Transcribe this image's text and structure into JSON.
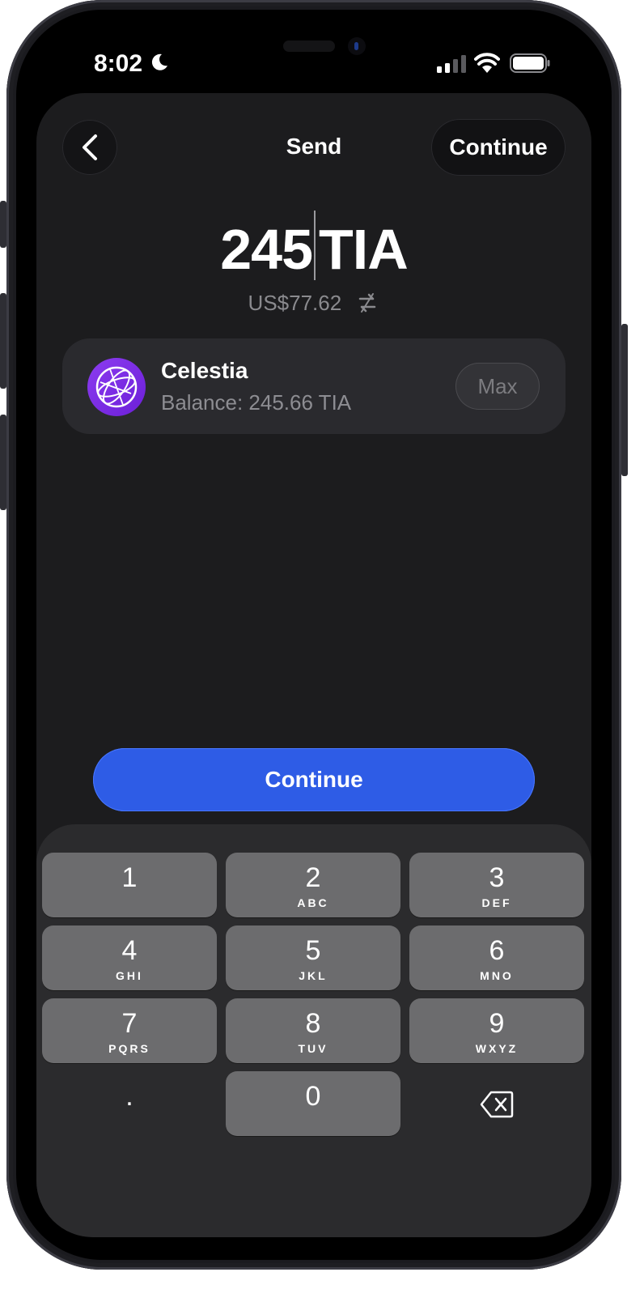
{
  "status_bar": {
    "time": "8:02"
  },
  "nav": {
    "title": "Send",
    "continue_label": "Continue"
  },
  "amount": {
    "value": "245",
    "unit": "TIA",
    "fiat": "US$77.62"
  },
  "token": {
    "name": "Celestia",
    "balance": "Balance: 245.66 TIA",
    "max_label": "Max",
    "logo_color": "#7b2ff0"
  },
  "primary_button": {
    "label": "Continue",
    "color": "#2e5ce6"
  },
  "keypad": {
    "keys": [
      {
        "digit": "1",
        "letters": ""
      },
      {
        "digit": "2",
        "letters": "ABC"
      },
      {
        "digit": "3",
        "letters": "DEF"
      },
      {
        "digit": "4",
        "letters": "GHI"
      },
      {
        "digit": "5",
        "letters": "JKL"
      },
      {
        "digit": "6",
        "letters": "MNO"
      },
      {
        "digit": "7",
        "letters": "PQRS"
      },
      {
        "digit": "8",
        "letters": "TUV"
      },
      {
        "digit": "9",
        "letters": "WXYZ"
      }
    ],
    "decimal": ".",
    "zero": "0",
    "delete_icon": "backspace-icon"
  }
}
